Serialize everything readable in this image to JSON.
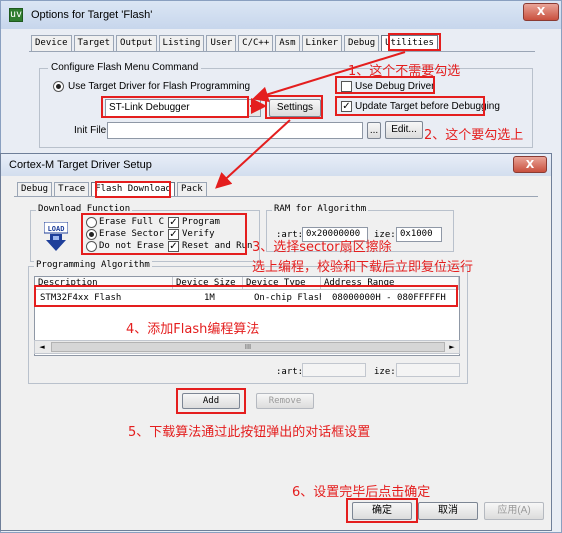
{
  "options_window": {
    "title": "Options for Target 'Flash'",
    "title_icon": "uv",
    "close_label": "X",
    "tabs": [
      "Device",
      "Target",
      "Output",
      "Listing",
      "User",
      "C/C++",
      "Asm",
      "Linker",
      "Debug",
      "Utilities"
    ],
    "group_label": "Configure Flash Menu Command",
    "radio_label": "Use Target Driver for Flash Programming",
    "driver_value": "ST-Link Debugger",
    "settings_label": "Settings",
    "use_debug_driver_label": "Use Debug Driver",
    "update_target_label": "Update Target before Debugging",
    "check_mark": "✓",
    "init_file_label": "Init File:",
    "browse_label": "...",
    "edit_label": "Edit..."
  },
  "driver_window": {
    "title": "Cortex-M Target Driver Setup",
    "close_label": "X",
    "tabs": [
      "Debug",
      "Trace",
      "Flash Download",
      "Pack"
    ],
    "download_function": {
      "label": "Download Function",
      "icon_text": "LOAD",
      "radios": [
        "Erase Full C",
        "Erase Sector",
        "Do not Erase"
      ],
      "checks": [
        "Program",
        "Verify",
        "Reset and Run"
      ]
    },
    "ram": {
      "label": "RAM for Algorithm",
      "start_label": ":art:",
      "start_value": "0x20000000",
      "size_label": "ize:",
      "size_value": "0x1000"
    },
    "programming_algorithm": {
      "label": "Programming Algorithm",
      "columns": [
        "Description",
        "Device Size",
        "Device Type",
        "Address Range"
      ],
      "row": [
        "STM32F4xx Flash",
        "1M",
        "On-chip Flash",
        "08000000H - 080FFFFFH"
      ],
      "scroll_left": "◄",
      "scroll_right": "►",
      "scroll_thumb": "III",
      "start_label": ":art:",
      "size_label": "ize:"
    },
    "add_label": "Add",
    "remove_label": "Remove",
    "ok_label": "确定",
    "cancel_label": "取消",
    "apply_label": "应用(A)"
  },
  "annotations": {
    "a1": "1、这个不需要勾选",
    "a2": "2、这个要勾选上",
    "a3_line1": "3、选择sector扇区擦除",
    "a3_line2": "选上编程，校验和下载后立即复位运行",
    "a4": "4、添加Flash编程算法",
    "a5": "5、下载算法通过此按钮弹出的对话框设置",
    "a6": "6、设置完毕后点击确定"
  },
  "colors": {
    "annotation": "#e41e1e",
    "title_bar": "#c7d6ec"
  }
}
